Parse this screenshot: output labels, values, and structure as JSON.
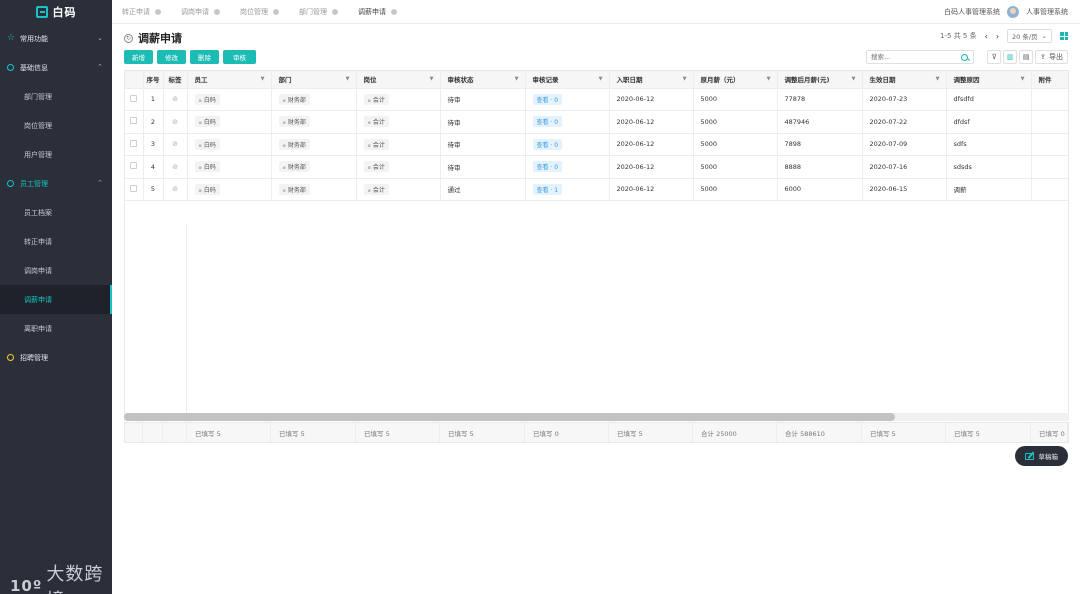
{
  "app": {
    "logo_text": "白码",
    "system_name": "白码人事管理系统",
    "user_name": "人事管理系统"
  },
  "tabs": [
    {
      "label": "转正申请"
    },
    {
      "label": "调岗申请"
    },
    {
      "label": "岗位管理"
    },
    {
      "label": "部门管理"
    },
    {
      "label": "调薪申请"
    }
  ],
  "sidebar": {
    "common": "常用功能",
    "basic": "基础信息",
    "basic_items": [
      "部门管理",
      "岗位管理",
      "用户管理"
    ],
    "employee": "员工管理",
    "employee_items": [
      "员工档案",
      "转正申请",
      "调岗申请",
      "调薪申请",
      "离职申请"
    ],
    "recruit": "招聘管理"
  },
  "page": {
    "title": "调薪申请",
    "pager_text": "1-5 共 5 条",
    "page_size": "20 条/页",
    "search_placeholder": "搜索...",
    "export_label": "导出",
    "buttons": {
      "add": "新增",
      "edit": "修改",
      "delete": "删除",
      "audit": "审核"
    }
  },
  "table": {
    "headers": [
      "序号",
      "标签",
      "员工",
      "部门",
      "岗位",
      "审核状态",
      "审核记录",
      "入职日期",
      "原月薪（元）",
      "调整后月薪(元)",
      "生效日期",
      "调整原因",
      "附件"
    ],
    "rows": [
      {
        "no": "1",
        "employee": "白码",
        "dept": "财务部",
        "post": "会计",
        "status": "待审",
        "record": "查看 · 0",
        "join": "2020-06-12",
        "old": "5000",
        "new": "77878",
        "effective": "2020-07-23",
        "reason": "dfsdfd"
      },
      {
        "no": "2",
        "employee": "白码",
        "dept": "财务部",
        "post": "会计",
        "status": "待审",
        "record": "查看 · 0",
        "join": "2020-06-12",
        "old": "5000",
        "new": "487946",
        "effective": "2020-07-22",
        "reason": "dfdsf"
      },
      {
        "no": "3",
        "employee": "白码",
        "dept": "财务部",
        "post": "会计",
        "status": "待审",
        "record": "查看 · 0",
        "join": "2020-06-12",
        "old": "5000",
        "new": "7898",
        "effective": "2020-07-09",
        "reason": "sdfs"
      },
      {
        "no": "4",
        "employee": "白码",
        "dept": "财务部",
        "post": "会计",
        "status": "待审",
        "record": "查看 · 0",
        "join": "2020-06-12",
        "old": "5000",
        "new": "8888",
        "effective": "2020-07-16",
        "reason": "sdsds"
      },
      {
        "no": "5",
        "employee": "白码",
        "dept": "财务部",
        "post": "会计",
        "status": "通过",
        "record": "查看 · 1",
        "join": "2020-06-12",
        "old": "5000",
        "new": "6000",
        "effective": "2020-06-15",
        "reason": "调薪"
      }
    ],
    "footer": [
      "已填写 5",
      "已填写 5",
      "已填写 5",
      "已填写 5",
      "已填写 0",
      "已填写 5",
      "合计 25000",
      "合计 588610",
      "已填写 5",
      "已填写 5",
      "已填写 0"
    ]
  },
  "draft": {
    "label": "草稿箱"
  },
  "watermark": {
    "logo": "10º",
    "text": "大数跨境"
  }
}
